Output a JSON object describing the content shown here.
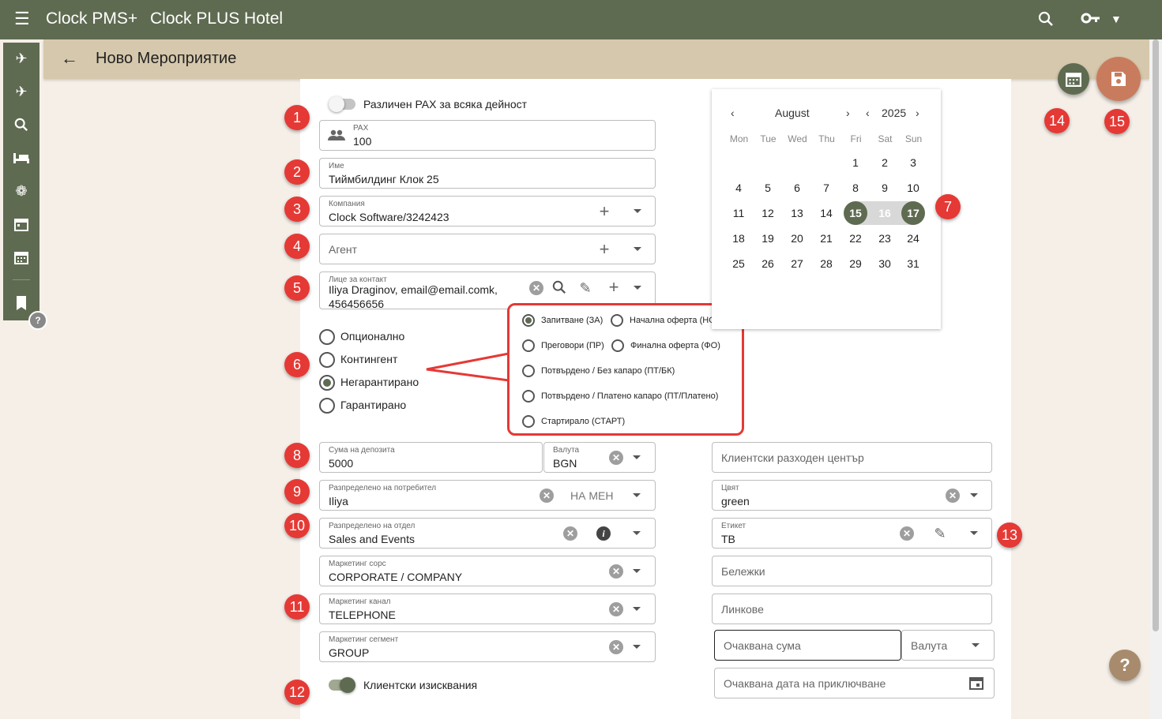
{
  "header": {
    "app_name": "Clock PMS+",
    "hotel_name": "Clock PLUS Hotel"
  },
  "page": {
    "title": "Ново Мероприятие"
  },
  "toggles": {
    "pax_per_activity": "Различен PAX за всяка дейност",
    "client_requirements": "Клиентски изисквания"
  },
  "form": {
    "pax": {
      "label": "PAX",
      "value": "100"
    },
    "name": {
      "label": "Име",
      "value": "Тиймбилдинг Клок 25"
    },
    "company": {
      "label": "Компания",
      "value": "Clock Software/3242423"
    },
    "agent": {
      "placeholder": "Агент"
    },
    "contact": {
      "label": "Лице за контакт",
      "value_line1": "Iliya Draginov, email@email.comk,",
      "value_line2": "456456656"
    },
    "deposit": {
      "label": "Сума на депозита",
      "value": "5000"
    },
    "deposit_currency": {
      "label": "Валута",
      "value": "BGN"
    },
    "assigned_user": {
      "label": "Разпределено на потребител",
      "value": "Iliya",
      "assign_me": "НА МЕН"
    },
    "assigned_department": {
      "label": "Разпределено на отдел",
      "value": "Sales and Events"
    },
    "marketing_source": {
      "label": "Маркетинг сорс",
      "value": "CORPORATE / COMPANY"
    },
    "marketing_channel": {
      "label": "Маркетинг канал",
      "value": "TELEPHONE"
    },
    "marketing_segment": {
      "label": "Маркетинг сегмент",
      "value": "GROUP"
    },
    "cost_center": {
      "placeholder": "Клиентски разходен център"
    },
    "color": {
      "label": "Цвят",
      "value": "green"
    },
    "tag": {
      "label": "Етикет",
      "value": "TB"
    },
    "notes": {
      "placeholder": "Бележки"
    },
    "links": {
      "placeholder": "Линкове"
    },
    "expected_amount": {
      "placeholder": "Очаквана сума"
    },
    "expected_currency": {
      "placeholder": "Валута"
    },
    "expected_close_date": {
      "placeholder": "Очаквана дата на приключване"
    }
  },
  "guarantee": {
    "options": [
      "Опционално",
      "Контингент",
      "Негарантирано",
      "Гарантирано"
    ],
    "selected": "Негарантирано"
  },
  "status_popup": {
    "options": [
      "Запитване (ЗА)",
      "Начална оферта (НО)",
      "Преговори (ПР)",
      "Финална оферта (ФО)",
      "Потвърдено / Без капаро (ПТ/БК)",
      "Потвърдено / Платено капаро (ПТ/Платено)",
      "Стартирало (СТАРТ)"
    ],
    "selected": "Запитване (ЗА)"
  },
  "calendar": {
    "month": "August",
    "year": "2025",
    "weekdays": [
      "Mon",
      "Tue",
      "Wed",
      "Thu",
      "Fri",
      "Sat",
      "Sun"
    ],
    "first_weekday_index": 4,
    "days_in_month": 31,
    "range_start": 15,
    "range_end": 17
  },
  "badges": [
    "1",
    "2",
    "3",
    "4",
    "5",
    "6",
    "7",
    "8",
    "9",
    "10",
    "11",
    "12",
    "13",
    "14",
    "15"
  ],
  "help_label": "?",
  "colors": {
    "primary": "#5f6b51",
    "subbar": "#d6c8ac",
    "background": "#f5efe8",
    "save_fab": "#c97c5d",
    "help_fab": "#a78b6c",
    "badge": "#e53935"
  },
  "icons": {
    "topbar": [
      "menu-icon",
      "search-icon",
      "key-icon",
      "chevron-down-icon"
    ],
    "sidenav": [
      "arrivals-icon",
      "departures-icon",
      "search-icon",
      "bed-icon",
      "leaf-icon",
      "calendar-icon",
      "calendar-grid-icon",
      "bookmark-icon"
    ]
  }
}
